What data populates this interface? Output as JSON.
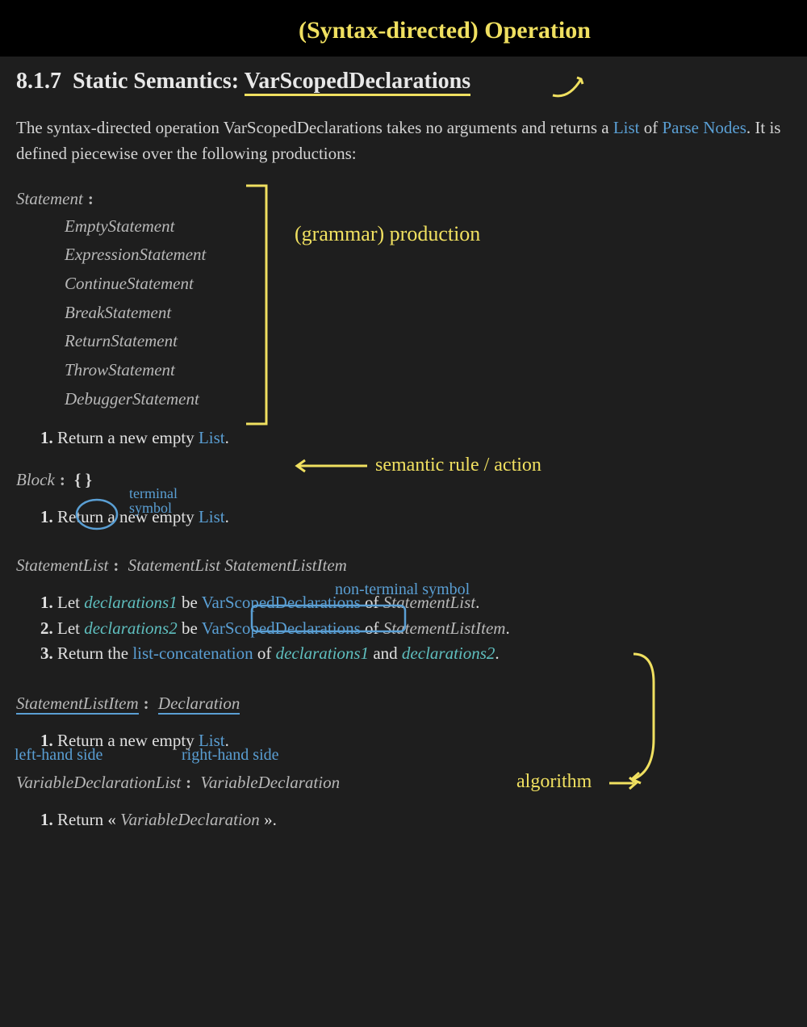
{
  "top_annotation": "(Syntax-directed) Operation",
  "heading_num": "8.1.7",
  "heading_prefix": "Static Semantics:",
  "heading_op": "VarScopedDeclarations",
  "intro_1": "The syntax-directed operation VarScopedDeclarations takes no arguments and returns a ",
  "intro_list": "List",
  "intro_2": " of ",
  "intro_parse": "Parse Nodes",
  "intro_3": ". It is defined piecewise over the following productions:",
  "prod1_head": "Statement",
  "prod1_alts": [
    "EmptyStatement",
    "ExpressionStatement",
    "ContinueStatement",
    "BreakStatement",
    "ReturnStatement",
    "ThrowStatement",
    "DebuggerStatement"
  ],
  "step_return_empty_a": "Return a new empty ",
  "step_return_empty_b": "List",
  "step_return_empty_c": ".",
  "prod2_head": "Block",
  "prod2_rhs_open": "{",
  "prod2_rhs_close": "}",
  "prod3_head": "StatementList",
  "prod3_rhs1": "StatementList",
  "prod3_rhs2": "StatementListItem",
  "p3_s1_a": "Let ",
  "p3_s1_var": "declarations1",
  "p3_s1_b": " be ",
  "p3_s1_link": "VarScopedDeclarations",
  "p3_s1_c": " of ",
  "p3_s1_nt": "StatementList",
  "p3_s1_d": ".",
  "p3_s2_var": "declarations2",
  "p3_s2_nt": "StatementListItem",
  "p3_s3_a": "Return the ",
  "p3_s3_link": "list-concatenation",
  "p3_s3_b": " of ",
  "p3_s3_c": " and ",
  "prod4_head": "StatementListItem",
  "prod4_rhs": "Declaration",
  "prod5_head": "VariableDeclarationList",
  "prod5_rhs": "VariableDeclaration",
  "p5_s1_a": "Return « ",
  "p5_s1_nt": "VariableDeclaration",
  "p5_s1_b": " ».",
  "anno_grammar_prod": "(grammar) production",
  "anno_semantic_rule": "semantic rule / action",
  "anno_terminal1": "terminal",
  "anno_terminal2": "symbol",
  "anno_nonterminal": "non-terminal symbol",
  "anno_lhs": "left-hand side",
  "anno_rhs": "right-hand side",
  "anno_algorithm": "algorithm"
}
